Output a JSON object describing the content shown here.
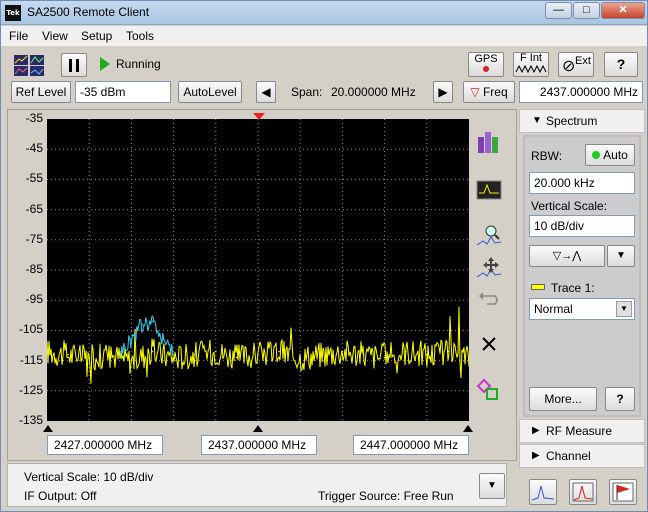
{
  "window": {
    "app_icon_text": "Tek",
    "title": "SA2500 Remote Client",
    "min_label": "—",
    "max_label": "□",
    "close_label": "✕"
  },
  "menu": {
    "file": "File",
    "view": "View",
    "setup": "Setup",
    "tools": "Tools"
  },
  "toolbar": {
    "status": "Running",
    "gps_label": "GPS",
    "fint_label": "F Int",
    "ext_label": "Ext",
    "help_label": "?"
  },
  "ref_bar": {
    "ref_level_label": "Ref Level",
    "ref_level_value": "-35 dBm",
    "autolevel_label": "AutoLevel",
    "span_label": "Span:",
    "span_value": "20.000000 MHz",
    "freq_label": "Freq",
    "freq_value": "2437.000000 MHz"
  },
  "plot": {
    "y_ticks": [
      "-35",
      "-45",
      "-55",
      "-65",
      "-75",
      "-85",
      "-95",
      "-105",
      "-115",
      "-125",
      "-135"
    ],
    "x_start": "2427.000000 MHz",
    "x_center": "2437.000000 MHz",
    "x_end": "2447.000000 MHz",
    "trace_color": "#ffff00",
    "maxhold_color": "#33ccee",
    "grid_color": "#8a8a8a"
  },
  "chart_data": {
    "type": "line",
    "xlabel": "",
    "ylabel": "",
    "x_unit": "MHz",
    "y_unit": "dBm",
    "xlim": [
      2427,
      2447
    ],
    "ylim": [
      -135,
      -35
    ],
    "y_ticks": [
      -35,
      -45,
      -55,
      -65,
      -75,
      -85,
      -95,
      -105,
      -115,
      -125,
      -135
    ],
    "series": [
      {
        "color": "#ffff00",
        "x": [
          2427,
          2428,
          2429,
          2430,
          2431,
          2432,
          2433,
          2434,
          2435,
          2436,
          2437,
          2438,
          2439,
          2440,
          2441,
          2442,
          2443,
          2444,
          2445,
          2446,
          2447
        ],
        "values": [
          -112,
          -113,
          -114,
          -113,
          -115,
          -112,
          -114,
          -113,
          -112,
          -114,
          -113,
          -112,
          -114,
          -113,
          -112,
          -113,
          -114,
          -112,
          -113,
          -112,
          -114
        ]
      },
      {
        "color": "#33ccee",
        "x": [
          2430.5,
          2431,
          2431.5,
          2432,
          2432.5,
          2433
        ],
        "values": [
          -112,
          -108,
          -103,
          -102,
          -108,
          -113
        ]
      }
    ]
  },
  "side": {
    "spectrum_label": "Spectrum",
    "rbw_label": "RBW:",
    "auto_label": "Auto",
    "rbw_value": "20.000 kHz",
    "vscale_label": "Vertical Scale:",
    "vscale_value": "10 dB/div",
    "trace_label": "Trace 1:",
    "trace_mode": "Normal",
    "more_label": "More...",
    "help_label": "?",
    "rf_measure_label": "RF Measure",
    "channel_label": "Channel"
  },
  "status": {
    "vertical_scale": "Vertical Scale: 10 dB/div",
    "if_output": "IF Output: Off",
    "trigger_source": "Trigger Source: Free Run"
  }
}
